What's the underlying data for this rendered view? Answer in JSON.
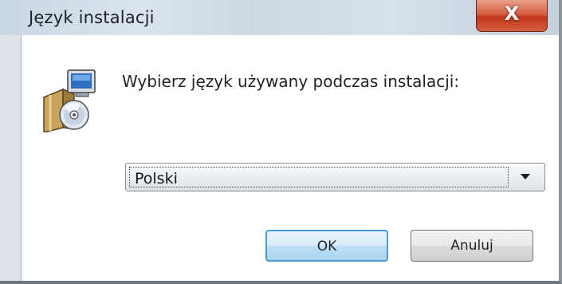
{
  "window": {
    "title": "Język instalacji",
    "close_label": "X"
  },
  "dialog": {
    "icon": "installer-icon",
    "prompt": "Wybierz język używany podczas instalacji:",
    "language_select": {
      "selected": "Polski"
    },
    "ok_label": "OK",
    "cancel_label": "Anuluj"
  },
  "colors": {
    "close_button": "#c2361c",
    "ok_button_border": "#4a9ad6",
    "dialog_background": "#ffffff",
    "title_bar": "#d4dde6"
  }
}
